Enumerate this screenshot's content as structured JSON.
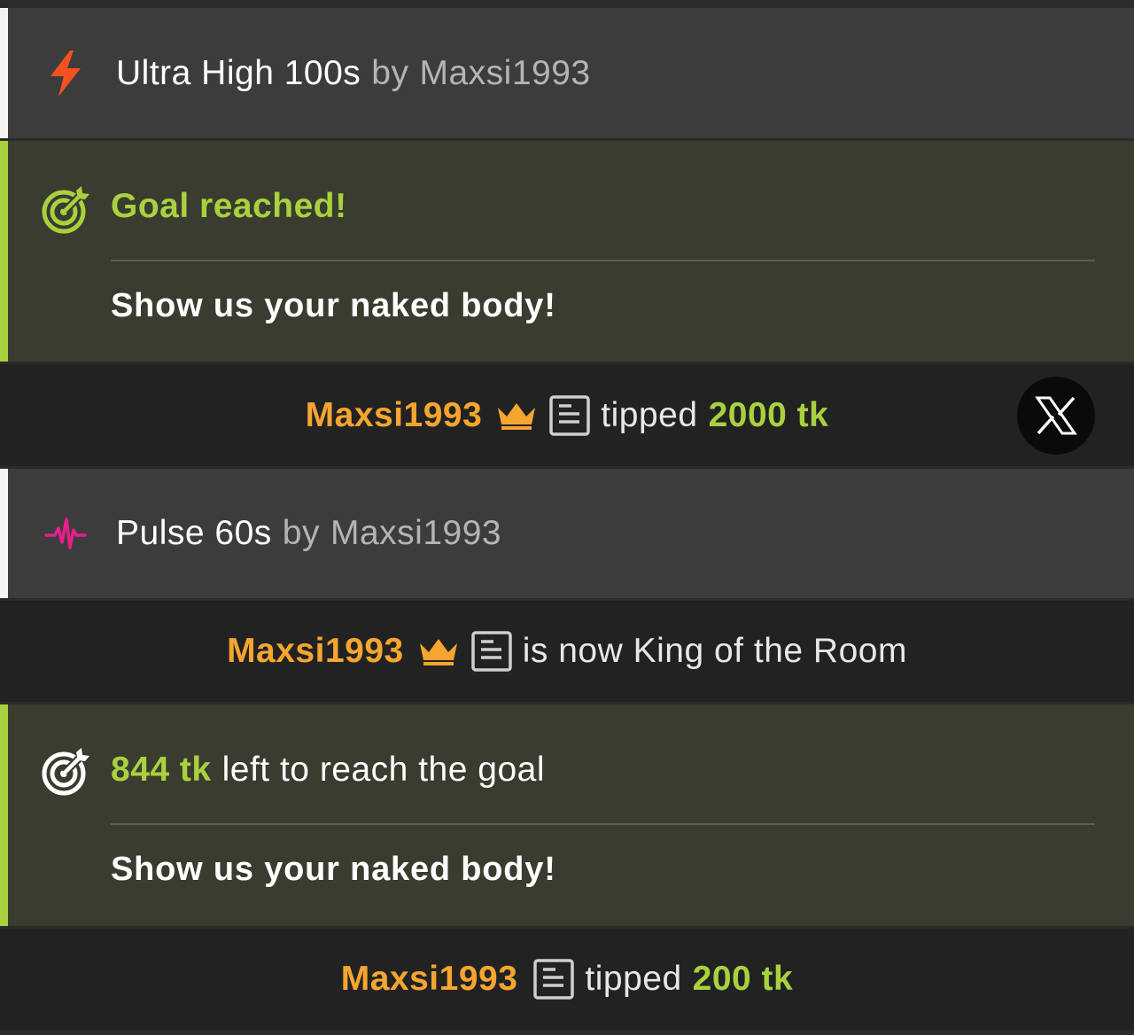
{
  "colors": {
    "goal_accent": "#a9d13f",
    "username": "#f5a530",
    "toy_lightning": "#f4511e",
    "toy_pulse": "#e91e8c",
    "toy_row_bg": "#3c3c3c",
    "goal_row_bg": "#393c2e",
    "event_row_bg": "#222222"
  },
  "feed": {
    "toy1": {
      "icon": "lightning-icon",
      "name": "Ultra High 100s",
      "by": "by",
      "user": "Maxsi1993"
    },
    "goal1": {
      "icon": "target-icon",
      "headline": "Goal reached!",
      "description": "Show us your naked body!"
    },
    "tip1": {
      "username": "Maxsi1993",
      "crown_icon": "crown-icon",
      "note_icon": "note-icon",
      "action": "tipped",
      "amount": "2000 tk",
      "close_icon": "x-close-icon"
    },
    "toy2": {
      "icon": "pulse-icon",
      "name": "Pulse 60s",
      "by": "by",
      "user": "Maxsi1993"
    },
    "king": {
      "username": "Maxsi1993",
      "crown_icon": "crown-icon",
      "note_icon": "note-icon",
      "text": "is now King of the Room"
    },
    "goal2": {
      "icon": "target-icon",
      "amount": "844 tk",
      "rest": "left to reach the goal",
      "description": "Show us your naked body!"
    },
    "tip2": {
      "username": "Maxsi1993",
      "note_icon": "note-icon",
      "action": "tipped",
      "amount": "200 tk"
    }
  }
}
